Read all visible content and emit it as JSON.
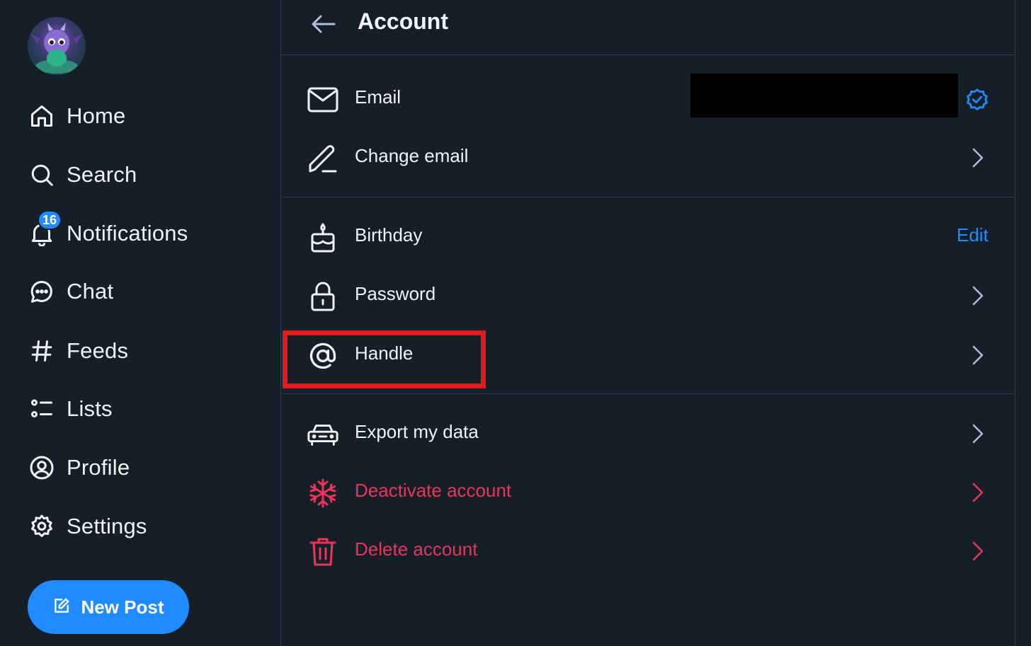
{
  "sidebar": {
    "nav": [
      {
        "label": "Home",
        "icon": "home-icon"
      },
      {
        "label": "Search",
        "icon": "search-icon"
      },
      {
        "label": "Notifications",
        "icon": "bell-icon",
        "badge": "16"
      },
      {
        "label": "Chat",
        "icon": "chat-bubble-icon"
      },
      {
        "label": "Feeds",
        "icon": "hashtag-icon"
      },
      {
        "label": "Lists",
        "icon": "list-icon"
      },
      {
        "label": "Profile",
        "icon": "user-circle-icon"
      },
      {
        "label": "Settings",
        "icon": "gear-icon"
      }
    ],
    "new_post_label": "New Post"
  },
  "header": {
    "title": "Account"
  },
  "account": {
    "email_label": "Email",
    "change_email_label": "Change email",
    "birthday_label": "Birthday",
    "birthday_edit": "Edit",
    "password_label": "Password",
    "handle_label": "Handle",
    "export_label": "Export my data",
    "deactivate_label": "Deactivate account",
    "delete_label": "Delete account"
  },
  "colors": {
    "background": "#161e27",
    "accent": "#208bfe",
    "danger": "#e8365b",
    "highlight_box": "#e01b1b",
    "divider": "#2e4052"
  }
}
